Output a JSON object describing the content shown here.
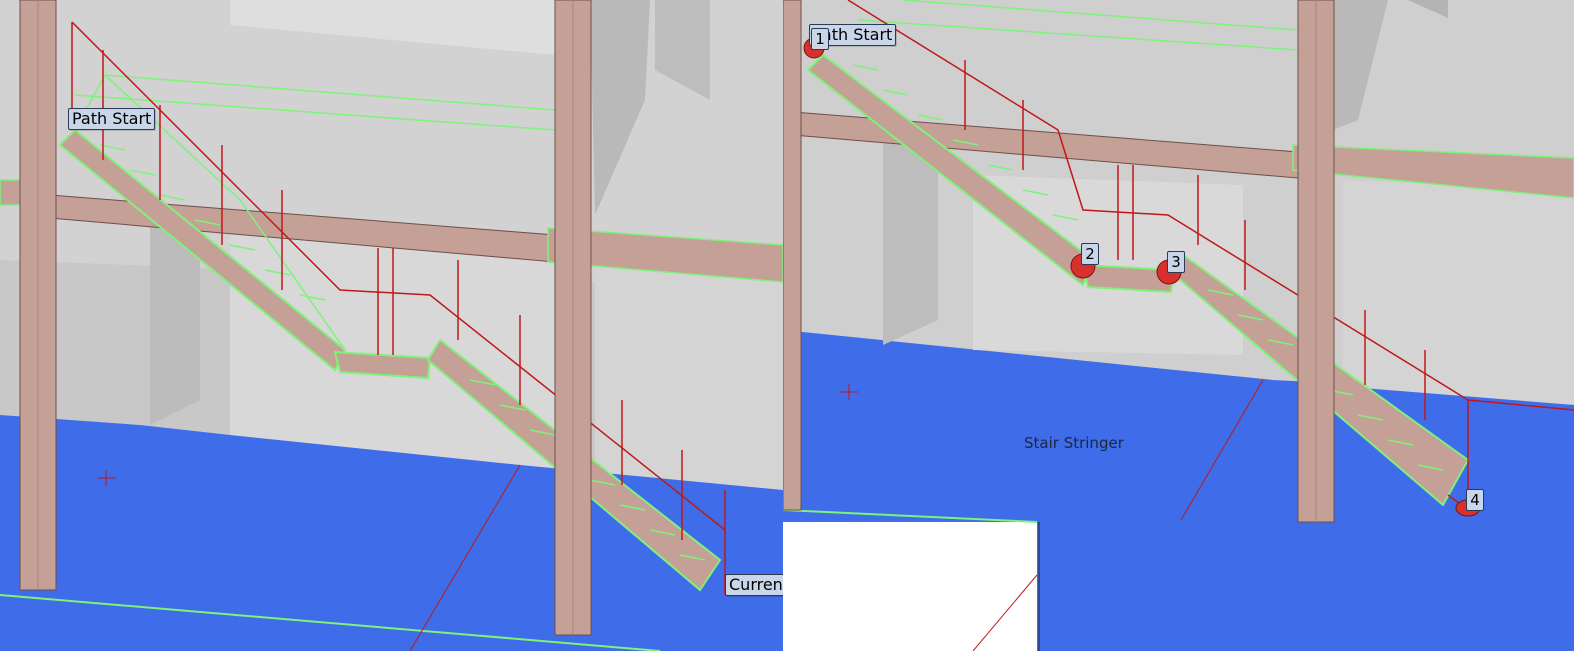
{
  "left_view": {
    "labels": {
      "path_start": "Path Start",
      "current_route_point": "Current Route Point"
    }
  },
  "right_view": {
    "labels": {
      "path_start": "Path Start",
      "stair_stringer": "Stair Stringer"
    },
    "route_points": [
      "1",
      "2",
      "3",
      "4"
    ]
  },
  "colors": {
    "floor": "#3f6ce9",
    "wall": "#cfcfcf",
    "steel": "#c4a097",
    "highlight": "#7ff27a",
    "handrail": "#c01818",
    "marker": "#d8302c",
    "tag_bg": "#c9d6ea"
  }
}
